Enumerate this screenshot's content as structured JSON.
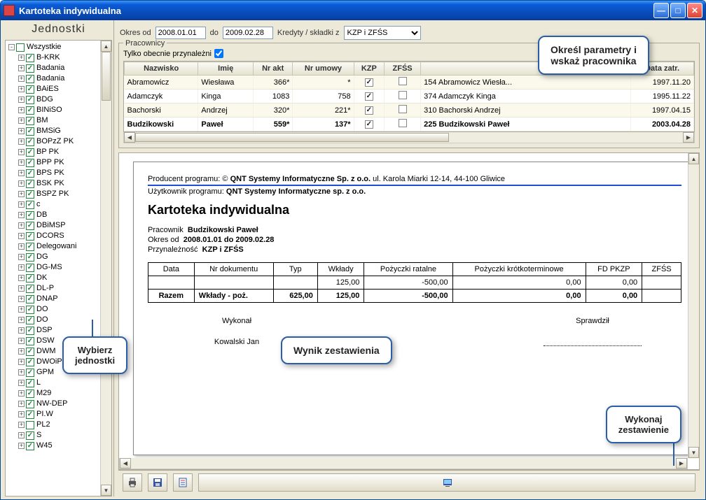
{
  "window": {
    "title": "Kartoteka indywidualna"
  },
  "left": {
    "header": "Jednostki"
  },
  "tree": {
    "root": "Wszystkie",
    "items": [
      {
        "label": "B-KRK",
        "c": true
      },
      {
        "label": "Badania",
        "c": true
      },
      {
        "label": "Badania",
        "c": true
      },
      {
        "label": "BAiES",
        "c": true
      },
      {
        "label": "BDG",
        "c": true
      },
      {
        "label": "BINiSO",
        "c": true
      },
      {
        "label": "BM",
        "c": true
      },
      {
        "label": "BMSiG",
        "c": true
      },
      {
        "label": "BOPzZ PK",
        "c": true
      },
      {
        "label": "BP PK",
        "c": true
      },
      {
        "label": "BPP PK",
        "c": true
      },
      {
        "label": "BPS PK",
        "c": true
      },
      {
        "label": "BSK PK",
        "c": true
      },
      {
        "label": "BSPZ PK",
        "c": true
      },
      {
        "label": "c",
        "c": true
      },
      {
        "label": "DB",
        "c": true
      },
      {
        "label": "DBiMSP",
        "c": true
      },
      {
        "label": "DCORS",
        "c": true
      },
      {
        "label": "Delegowani",
        "c": true
      },
      {
        "label": "DG",
        "c": true
      },
      {
        "label": "DG-MS",
        "c": true
      },
      {
        "label": "DK",
        "c": true
      },
      {
        "label": "DL-P",
        "c": true
      },
      {
        "label": "DNAP",
        "c": true
      },
      {
        "label": "DO",
        "c": true
      },
      {
        "label": "DO",
        "c": true
      },
      {
        "label": "DSP",
        "c": true
      },
      {
        "label": "DSW",
        "c": true
      },
      {
        "label": "DWM",
        "c": true
      },
      {
        "label": "DWOiP",
        "c": true
      },
      {
        "label": "GPM",
        "c": true
      },
      {
        "label": "L",
        "c": true
      },
      {
        "label": "M29",
        "c": true
      },
      {
        "label": "NW-DEP",
        "c": true
      },
      {
        "label": "PI.W",
        "c": true
      },
      {
        "label": "PL2",
        "c": false
      },
      {
        "label": "S",
        "c": true
      },
      {
        "label": "W45",
        "c": true
      }
    ]
  },
  "filter": {
    "okres_od_label": "Okres od",
    "okres_od": "2008.01.01",
    "do_label": "do",
    "do": "2009.02.28",
    "kredyty_label": "Kredyty / składki z",
    "kredyty_value": "KZP i ZFŚS",
    "fieldset": "Pracownicy",
    "only_members": "Tylko obecnie przynależni"
  },
  "grid": {
    "headers": {
      "nazwisko": "Nazwisko",
      "imie": "Imię",
      "nrakt": "Nr akt",
      "nrumowy": "Nr umowy",
      "kzp": "KZP",
      "zfss": "ZFŚS",
      "fullname": "",
      "data": "Data zatr."
    },
    "rows": [
      {
        "nazwisko": "Abramowicz",
        "imie": "Wiesława",
        "nrakt": "366*",
        "nrumowy": "*",
        "kzp": true,
        "zfss": false,
        "full": "154 Abramowicz Wiesła...",
        "data": "1997.11.20"
      },
      {
        "nazwisko": "Adamczyk",
        "imie": "Kinga",
        "nrakt": "1083",
        "nrumowy": "758",
        "kzp": true,
        "zfss": false,
        "full": "374 Adamczyk Kinga",
        "data": "1995.11.22"
      },
      {
        "nazwisko": "Bachorski",
        "imie": "Andrzej",
        "nrakt": "320*",
        "nrumowy": "221*",
        "kzp": true,
        "zfss": false,
        "full": "310 Bachorski Andrzej",
        "data": "1997.04.15"
      },
      {
        "nazwisko": "Budzikowski",
        "imie": "Paweł",
        "nrakt": "559*",
        "nrumowy": "137*",
        "kzp": true,
        "zfss": false,
        "full": "225 Budzikowski Paweł",
        "data": "2003.04.28",
        "sel": true
      }
    ]
  },
  "report": {
    "producer_label": "Producent programu: ©",
    "producer_name": "QNT Systemy Informatyczne Sp. z o.o.",
    "producer_addr": " ul. Karola Miarki 12-14, 44-100 Gliwice",
    "user_label": "Użytkownik programu:",
    "user_name": "QNT Systemy Informatyczne sp. z o.o.",
    "title": "Kartoteka indywidualna",
    "pracownik_label": "Pracownik",
    "pracownik": "Budzikowski Paweł",
    "okres_label": "Okres od",
    "okres": "2008.01.01 do 2009.02.28",
    "przyn_label": "Przynależność",
    "przyn": "KZP i ZFŚS",
    "table": {
      "headers": [
        "Data",
        "Nr dokumentu",
        "Typ",
        "Wkłady",
        "Pożyczki ratalne",
        "Pożyczki krótkoterminowe",
        "FD PKZP",
        "ZFŚS"
      ],
      "row1": [
        "",
        "",
        "",
        "125,00",
        "-500,00",
        "0,00",
        "0,00",
        ""
      ],
      "sum": [
        "Razem",
        "Wkłady - poż.",
        "625,00",
        "125,00",
        "-500,00",
        "0,00",
        "0,00",
        ""
      ]
    },
    "wykonal": "Wykonał",
    "wykonal_name": "Kowalski Jan",
    "sprawdzil": "Sprawdził"
  },
  "callouts": {
    "tl": "Wybierz\njednostki",
    "tr": "Określ parametry i\nwskaż pracownika",
    "mid": "Wynik zestawienia",
    "br": "Wykonaj\nzestawienie"
  }
}
